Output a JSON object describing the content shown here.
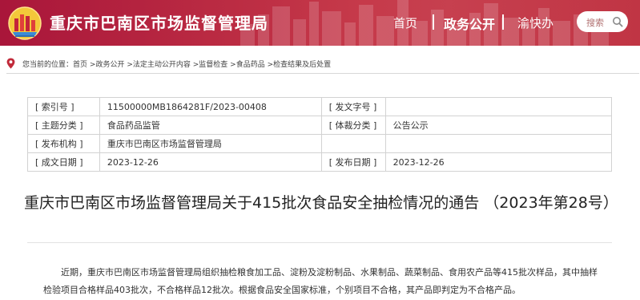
{
  "header": {
    "site_title": "重庆市巴南区市场监督管理局",
    "nav": [
      {
        "label": "首页"
      },
      {
        "label": "政务公开"
      },
      {
        "label": "渝快办"
      }
    ],
    "search_placeholder": "搜索",
    "colors": {
      "brand_red": "#b81e37"
    }
  },
  "breadcrumb": {
    "prefix": "您当前的位置：",
    "items": [
      "首页",
      "政务公开",
      "法定主动公开内容",
      "监督检查",
      "食品药品",
      "检查结果及后处置"
    ],
    "separator": " >"
  },
  "info": {
    "index_no": {
      "label": "[ 索引号 ]",
      "value": "11500000MB1864281F/2023-00408"
    },
    "doc_no": {
      "label": "[ 发文字号 ]",
      "value": ""
    },
    "topic": {
      "label": "[ 主题分类 ]",
      "value": "食品药品监管"
    },
    "genre": {
      "label": "[ 体裁分类 ]",
      "value": "公告公示"
    },
    "issuer": {
      "label": "[ 发布机构 ]",
      "value": "重庆市巴南区市场监督管理局"
    },
    "created": {
      "label": "[ 成文日期 ]",
      "value": "2023-12-26"
    },
    "published": {
      "label": "[ 发布日期 ]",
      "value": "2023-12-26"
    }
  },
  "article": {
    "title": "重庆市巴南区市场监督管理局关于415批次食品安全抽检情况的通告 （2023年第28号）",
    "body": "近期，重庆市巴南区市场监督管理局组织抽检粮食加工品、淀粉及淀粉制品、水果制品、蔬菜制品、食用农产品等415批次样品，其中抽样检验项目合格样品403批次，不合格样品12批次。根据食品安全国家标准，个别项目不合格，其产品即判定为不合格产品。"
  }
}
